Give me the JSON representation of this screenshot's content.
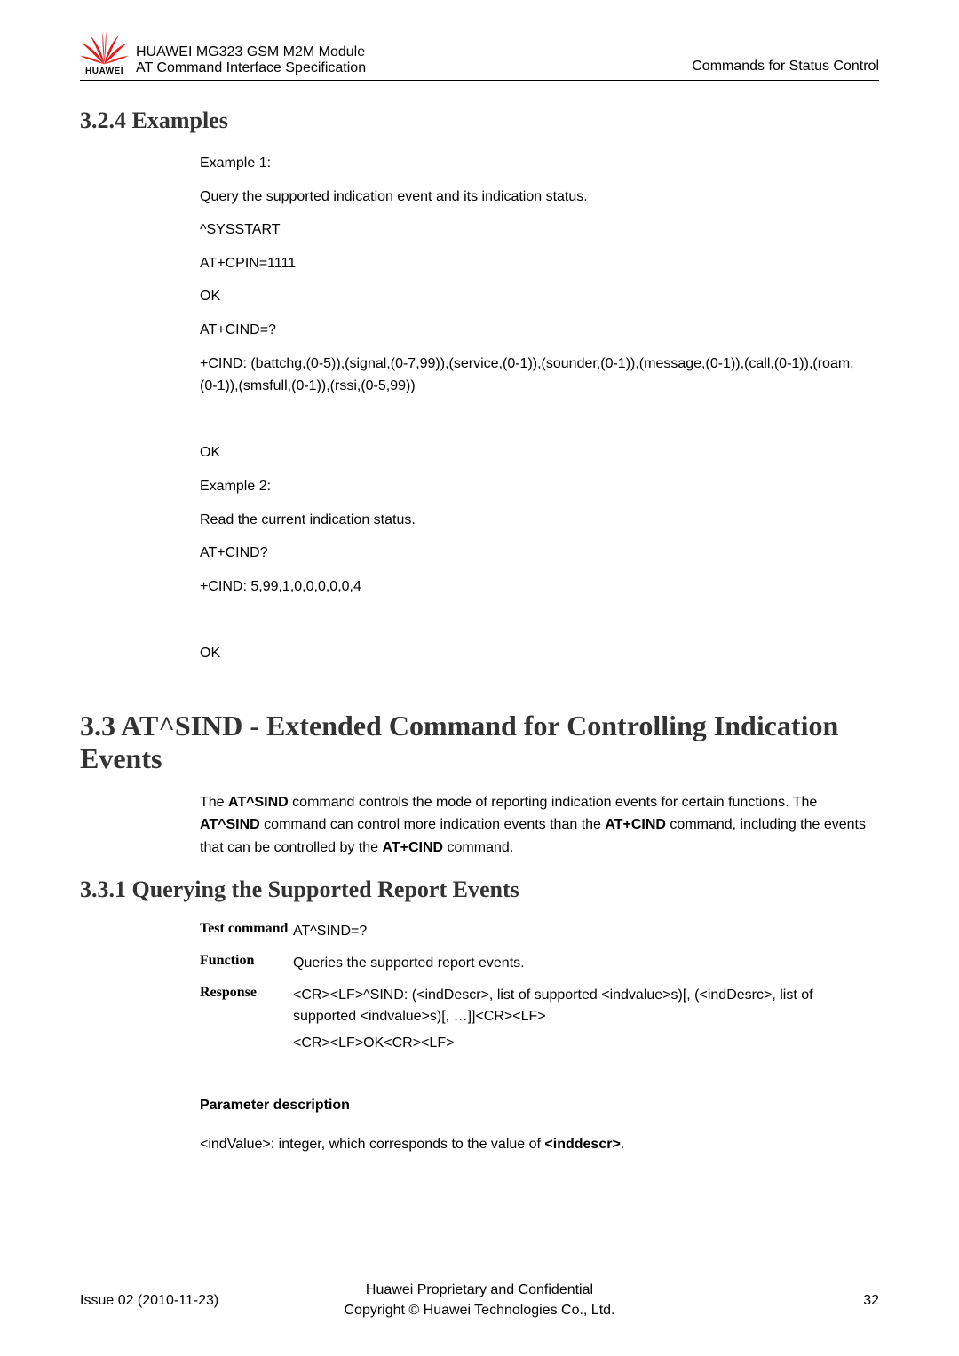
{
  "header": {
    "logo_label": "HUAWEI",
    "title1": "HUAWEI MG323 GSM M2M Module",
    "title2": "AT Command Interface Specification",
    "right": "Commands for Status Control"
  },
  "s324": {
    "heading": "3.2.4 Examples",
    "lines": [
      "Example 1:",
      "Query the supported indication event and its indication status.",
      "^SYSSTART",
      "AT+CPIN=1111",
      "OK",
      "AT+CIND=?",
      "+CIND:    (battchg,(0-5)),(signal,(0-7,99)),(service,(0-1)),(sounder,(0-1)),(message,(0-1)),(call,(0-1)),(roam,(0-1)),(smsfull,(0-1)),(rssi,(0-5,99))",
      " ",
      "OK",
      "Example 2:",
      "Read the current indication status.",
      "AT+CIND?",
      "+CIND: 5,99,1,0,0,0,0,0,4",
      " ",
      "OK"
    ]
  },
  "s33": {
    "heading": "3.3 AT^SIND - Extended Command for Controlling Indication Events",
    "intro_pre": "The ",
    "intro_b1": "AT^SIND",
    "intro_mid1": " command controls the mode of reporting indication events for certain functions. The ",
    "intro_b2": "AT^SIND",
    "intro_mid2": " command can control more indication events than the ",
    "intro_b3": "AT+CIND",
    "intro_mid3": " command, including the events that can be controlled by the ",
    "intro_b4": "AT+CIND",
    "intro_end": " command."
  },
  "s331": {
    "heading": "3.3.1 Querying the Supported Report Events",
    "rows": {
      "test_label": "Test command",
      "test_value": "AT^SIND=?",
      "func_label": "Function",
      "func_value": "Queries the supported report events.",
      "resp_label": "Response",
      "resp_line1": "<CR><LF>^SIND: (<indDescr>, list of supported <indvalue>s)[, (<indDesrc>, list of supported <indvalue>s)[, …]]<CR><LF>",
      "resp_line2": "<CR><LF>OK<CR><LF>"
    },
    "param_heading": "Parameter description",
    "param_pre": "<indValue>: integer, which corresponds to the value of ",
    "param_bold": "<inddescr>",
    "param_post": "."
  },
  "footer": {
    "left": "Issue 02 (2010-11-23)",
    "center1": "Huawei Proprietary and Confidential",
    "center2": "Copyright © Huawei Technologies Co., Ltd.",
    "right": "32"
  }
}
